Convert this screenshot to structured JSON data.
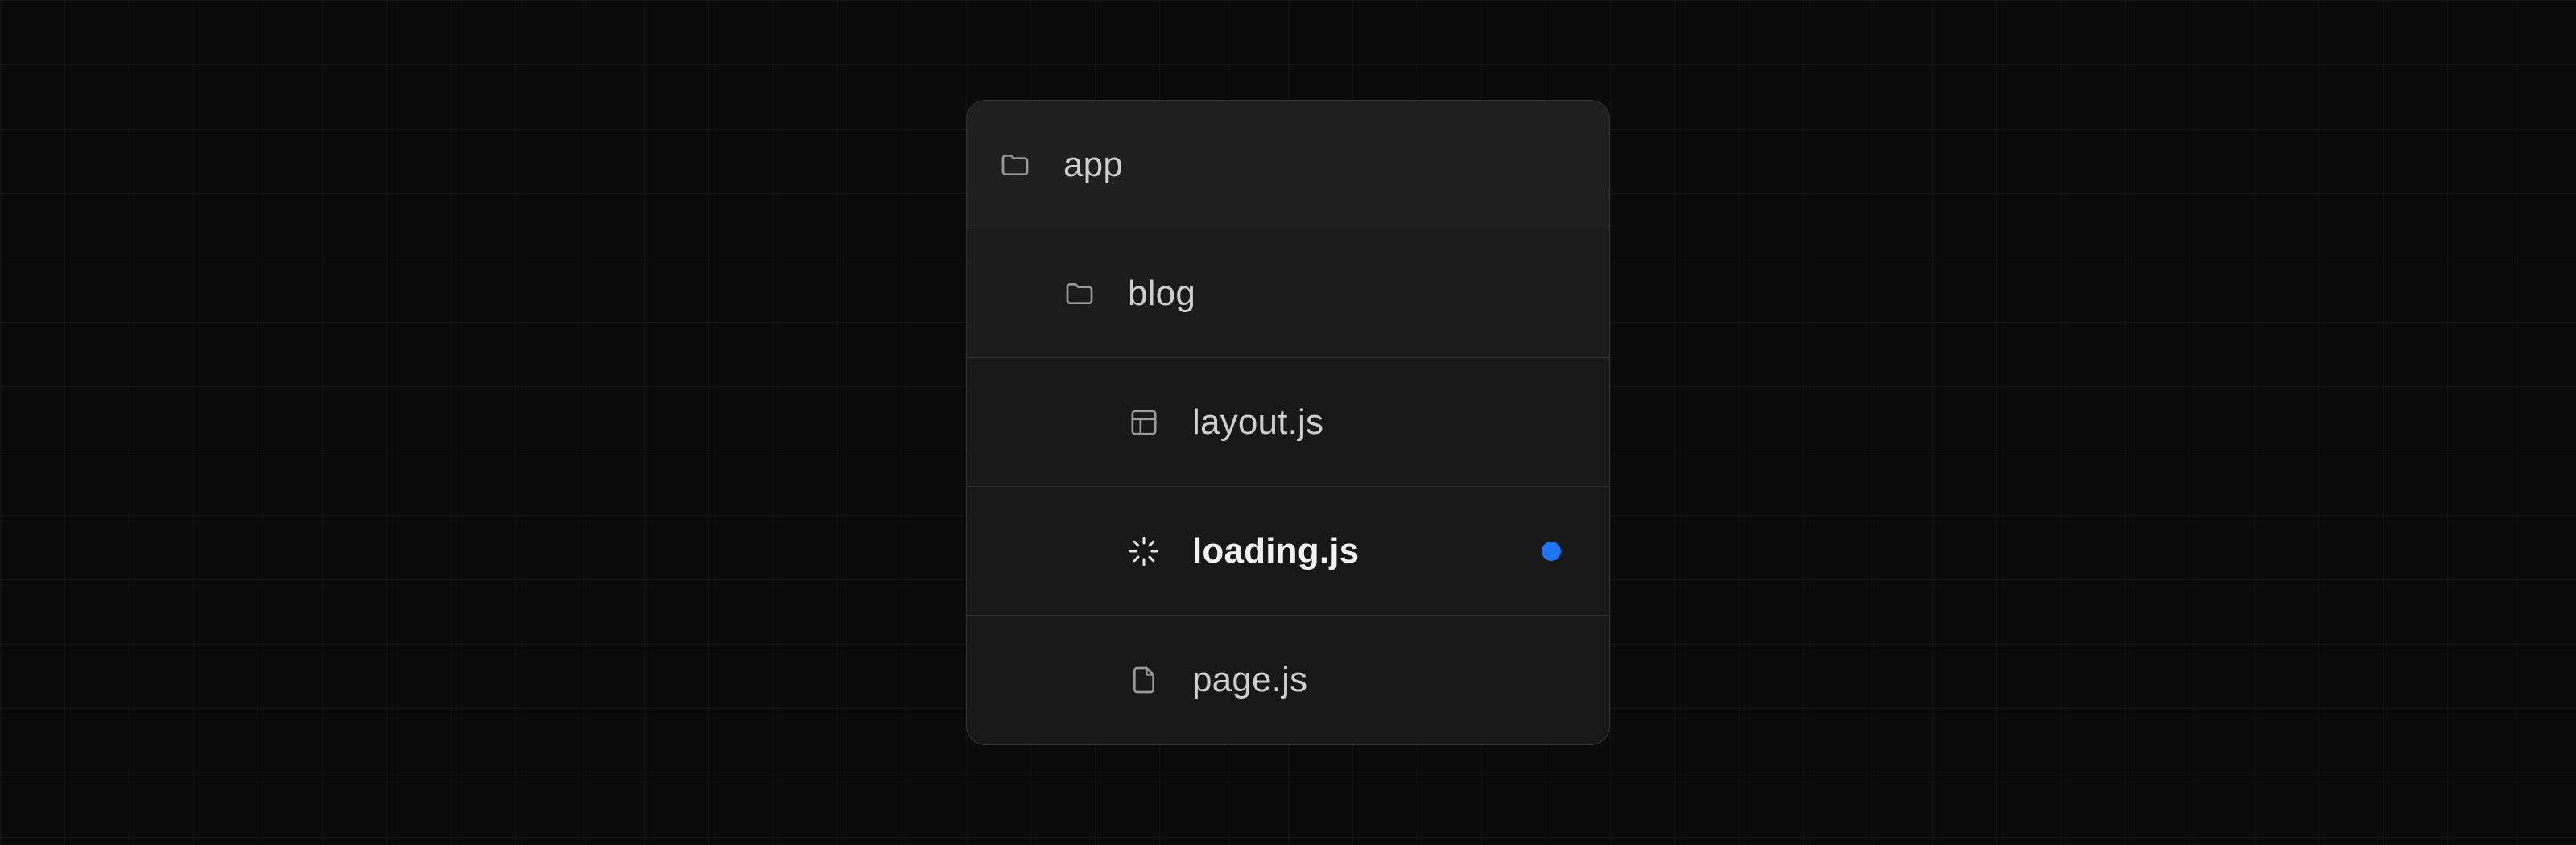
{
  "accent_color": "#1d74f5",
  "tree": [
    {
      "label": "app",
      "icon": "folder",
      "depth": 0,
      "highlight": false,
      "dot": false
    },
    {
      "label": "blog",
      "icon": "folder",
      "depth": 1,
      "highlight": false,
      "dot": false
    },
    {
      "label": "layout.js",
      "icon": "layout",
      "depth": 2,
      "highlight": false,
      "dot": false
    },
    {
      "label": "loading.js",
      "icon": "spinner",
      "depth": 2,
      "highlight": true,
      "dot": true
    },
    {
      "label": "page.js",
      "icon": "file",
      "depth": 2,
      "highlight": false,
      "dot": false
    }
  ]
}
